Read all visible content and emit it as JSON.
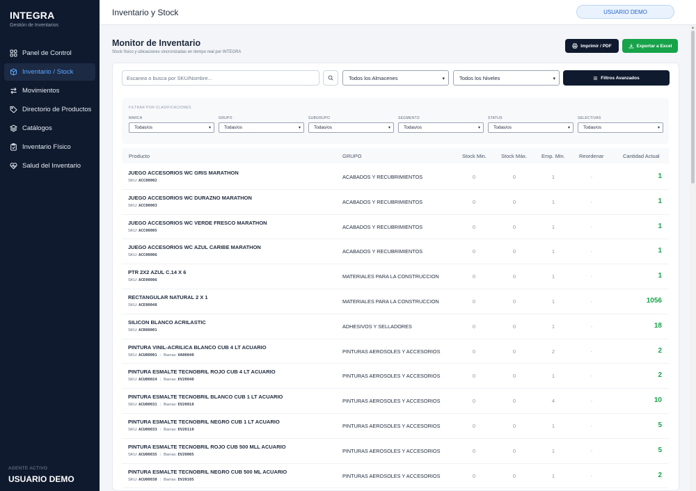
{
  "sidebar": {
    "brand": "INTEGRA",
    "brand_sub": "Gestión de Inventarios",
    "items": [
      {
        "label": "Panel de Control",
        "icon": "grid-icon",
        "active": false
      },
      {
        "label": "Inventario / Stock",
        "icon": "box-icon",
        "active": true
      },
      {
        "label": "Movimientos",
        "icon": "arrows-swap-icon",
        "active": false
      },
      {
        "label": "Directorio de Productos",
        "icon": "tag-icon",
        "active": false
      },
      {
        "label": "Catálogos",
        "icon": "layers-icon",
        "active": false
      },
      {
        "label": "Inventario Físico",
        "icon": "clipboard-icon",
        "active": false
      },
      {
        "label": "Salud del Inventario",
        "icon": "heart-pulse-icon",
        "active": false
      }
    ],
    "agent_label": "AGENTE ACTIVO",
    "agent_name": "USUARIO DEMO"
  },
  "header": {
    "title": "Inventario y Stock",
    "user": "USUARIO DEMO"
  },
  "page": {
    "title": "Monitor de Inventario",
    "subtitle": "Stock físico y ubicaciones sincronizadas en tiempo real por INTEGRA",
    "print_label": "Imprimir / PDF",
    "excel_label": "Exportar a Excel"
  },
  "toolbar": {
    "search_placeholder": "Escanea o busca por SKU/Nombre...",
    "warehouse": "Todos los Almacenes",
    "level": "Todos los Niveles",
    "advanced_filters": "Filtros Avanzados"
  },
  "filters": {
    "title": "FILTRAR POR CLASIFICACIONES",
    "groups": [
      {
        "label": "MARCA",
        "value": "Todas/os"
      },
      {
        "label": "GRUPO",
        "value": "Todas/os"
      },
      {
        "label": "SUBGRUPO",
        "value": "Todas/os"
      },
      {
        "label": "SEGMENTO",
        "value": "Todas/os"
      },
      {
        "label": "STATUS",
        "value": "Todas/os"
      },
      {
        "label": "SELECTIVAS",
        "value": "Todas/os"
      }
    ]
  },
  "table": {
    "columns": [
      "Producto",
      "GRUPO",
      "Stock Min.",
      "Stock Máx.",
      "Emp. Min.",
      "Reordenar",
      "Cantidad Actual"
    ],
    "sku_prefix": "SKU:",
    "barcode_prefix": "Barras:",
    "rows": [
      {
        "name": "JUEGO ACCESORIOS WC GRIS MARATHON",
        "sku": "ACC00002",
        "barcode": "",
        "group": "ACABADOS Y RECUBRIMIENTOS",
        "min": "0",
        "max": "0",
        "emp": "1",
        "reorder": "-",
        "qty": "1"
      },
      {
        "name": "JUEGO ACCESORIOS WC DURAZNO MARATHON",
        "sku": "ACC00003",
        "barcode": "",
        "group": "ACABADOS Y RECUBRIMIENTOS",
        "min": "0",
        "max": "0",
        "emp": "1",
        "reorder": "-",
        "qty": "1"
      },
      {
        "name": "JUEGO ACCESORIOS WC VERDE FRESCO MARATHON",
        "sku": "ACC00005",
        "barcode": "",
        "group": "ACABADOS Y RECUBRIMIENTOS",
        "min": "0",
        "max": "0",
        "emp": "1",
        "reorder": "-",
        "qty": "1"
      },
      {
        "name": "JUEGO ACCESORIOS WC AZUL CARIBE MARATHON",
        "sku": "ACC00006",
        "barcode": "",
        "group": "ACABADOS Y RECUBRIMIENTOS",
        "min": "0",
        "max": "0",
        "emp": "1",
        "reorder": "-",
        "qty": "1"
      },
      {
        "name": "PTR 2X2 AZUL C.14 X 6",
        "sku": "ACE00006",
        "barcode": "",
        "group": "MATERIALES PARA LA CONSTRUCCION",
        "min": "0",
        "max": "0",
        "emp": "1",
        "reorder": "-",
        "qty": "1"
      },
      {
        "name": "RECTANGULAR NATURAL 2 X 1",
        "sku": "ACE00048",
        "barcode": "",
        "group": "MATERIALES PARA LA CONSTRUCCION",
        "min": "0",
        "max": "0",
        "emp": "1",
        "reorder": "-",
        "qty": "1056"
      },
      {
        "name": "SILICON BLANCO ACRILASTIC",
        "sku": "ACR00001",
        "barcode": "",
        "group": "ADHESIVOS Y SELLADORES",
        "min": "0",
        "max": "0",
        "emp": "1",
        "reorder": "-",
        "qty": "18"
      },
      {
        "name": "PINTURA VINIL-ACRILICA BLANCO CUB 4 LT ACUARIO",
        "sku": "ACU00001",
        "barcode": "VA00040",
        "group": "PINTURAS AEROSOLES Y ACCESORIOS",
        "min": "0",
        "max": "0",
        "emp": "2",
        "reorder": "-",
        "qty": "2"
      },
      {
        "name": "PINTURA ESMALTE TECNOBRIL ROJO CUB 4 LT ACUARIO",
        "sku": "ACU00024",
        "barcode": "EV20040",
        "group": "PINTURAS AEROSOLES Y ACCESORIOS",
        "min": "0",
        "max": "0",
        "emp": "1",
        "reorder": "-",
        "qty": "2"
      },
      {
        "name": "PINTURA ESMALTE TECNOBRIL BLANCO CUB 1 LT ACUARIO",
        "sku": "ACU00031",
        "barcode": "EV20010",
        "group": "PINTURAS AEROSOLES Y ACCESORIOS",
        "min": "0",
        "max": "0",
        "emp": "4",
        "reorder": "-",
        "qty": "10"
      },
      {
        "name": "PINTURA ESMALTE TECNOBRIL NEGRO CUB 1 LT ACUARIO",
        "sku": "ACU00033",
        "barcode": "EV20110",
        "group": "PINTURAS AEROSOLES Y ACCESORIOS",
        "min": "0",
        "max": "0",
        "emp": "1",
        "reorder": "-",
        "qty": "5"
      },
      {
        "name": "PINTURA ESMALTE TECNOBRIL ROJO CUB 500 MLL ACUARIO",
        "sku": "ACU00035",
        "barcode": "EV20005",
        "group": "PINTURAS AEROSOLES Y ACCESORIOS",
        "min": "0",
        "max": "0",
        "emp": "1",
        "reorder": "-",
        "qty": "5"
      },
      {
        "name": "PINTURA ESMALTE TECNOBRIL NEGRO CUB 500 ML ACUARIO",
        "sku": "ACU00038",
        "barcode": "EV20105",
        "group": "PINTURAS AEROSOLES Y ACCESORIOS",
        "min": "0",
        "max": "0",
        "emp": "1",
        "reorder": "-",
        "qty": "2"
      }
    ]
  },
  "colors": {
    "sidebar_bg": "#0f1a2e",
    "active_accent": "#5fa7ff",
    "quantity": "#16a34a",
    "excel_button": "#16a34a"
  }
}
